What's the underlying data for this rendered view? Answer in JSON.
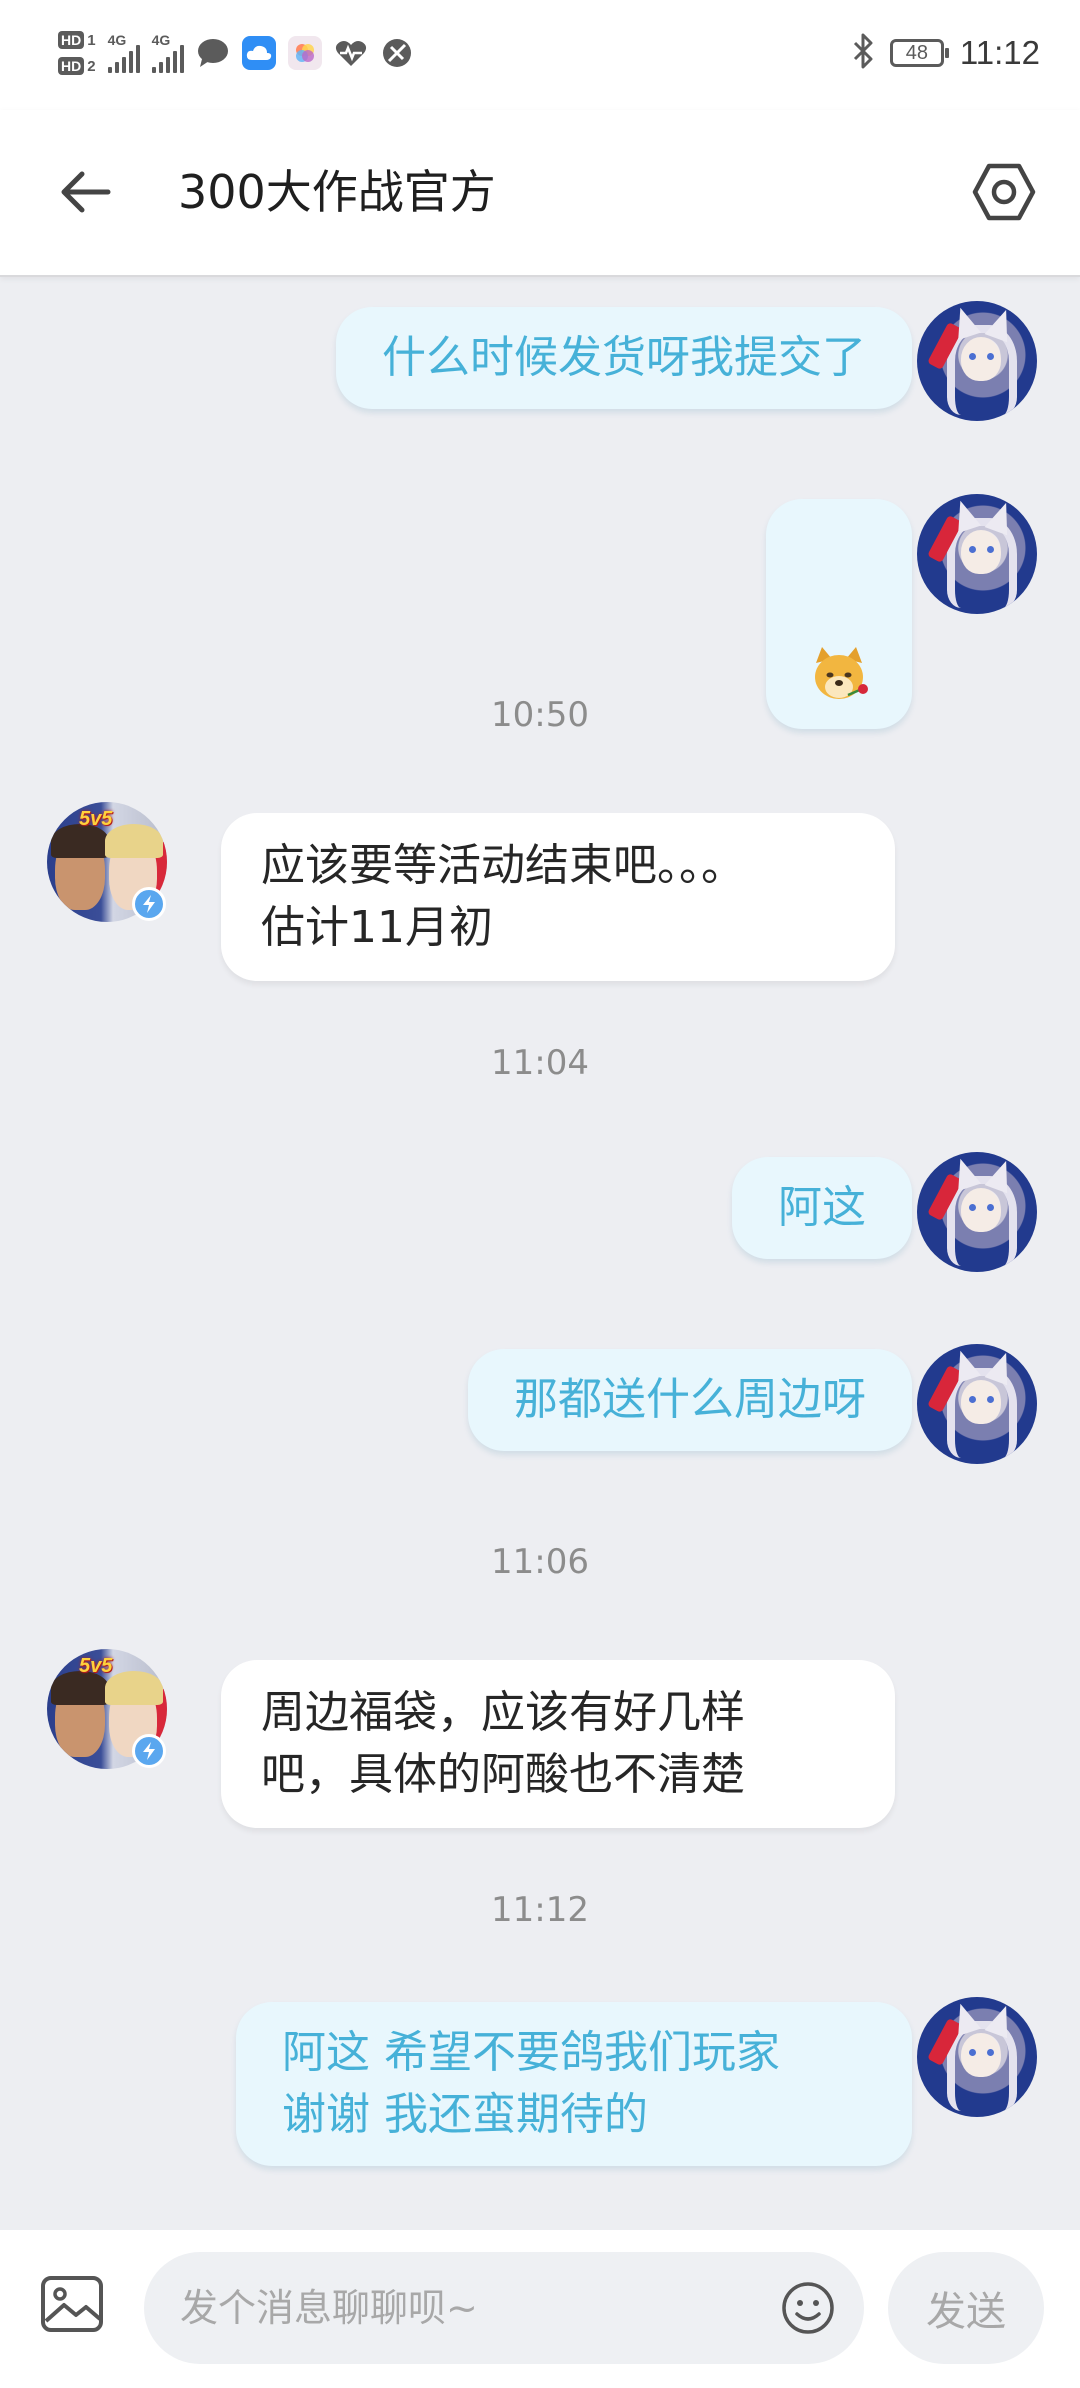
{
  "status_bar": {
    "sim1": "HD",
    "sim1_num": "1",
    "sim2": "HD",
    "sim2_num": "2",
    "net1": "4G",
    "net2": "4G",
    "battery": "48",
    "time": "11:12",
    "icons": [
      "message-icon",
      "cloud-icon",
      "gallery-icon",
      "health-icon",
      "vpn-icon",
      "bluetooth-icon"
    ]
  },
  "header": {
    "title": "300大作战官方",
    "back_icon": "arrow-left-icon",
    "settings_icon": "hexagon-settings-icon"
  },
  "messages": [
    {
      "sender": "me",
      "type": "text",
      "text": "什么时候发货呀我提交了"
    },
    {
      "sender": "me",
      "type": "sticker",
      "sticker": "doge-with-rose"
    },
    {
      "type": "time",
      "text": "10:50"
    },
    {
      "sender": "official",
      "type": "text",
      "text": "应该要等活动结束吧。。。\n估计11月初"
    },
    {
      "type": "time",
      "text": "11:04"
    },
    {
      "sender": "me",
      "type": "text",
      "text": "阿这"
    },
    {
      "sender": "me",
      "type": "text",
      "text": "那都送什么周边呀"
    },
    {
      "type": "time",
      "text": "11:06"
    },
    {
      "sender": "official",
      "type": "text",
      "text": "周边福袋，应该有好几样\n吧，具体的阿酸也不清楚"
    },
    {
      "type": "time",
      "text": "11:12"
    },
    {
      "sender": "me",
      "type": "text",
      "text": "阿这  希望不要鸽我们玩家\n谢谢 我还蛮期待的"
    }
  ],
  "official_avatar": {
    "badge_text": "5v5"
  },
  "input_bar": {
    "placeholder": "发个消息聊聊呗~",
    "value": "",
    "send_label": "发送"
  },
  "colors": {
    "background": "#edeef2",
    "my_bubble_bg": "#e8f7fd",
    "my_bubble_text": "#46b1d8",
    "other_bubble_bg": "#ffffff",
    "timestamp": "#8c8c8c"
  }
}
